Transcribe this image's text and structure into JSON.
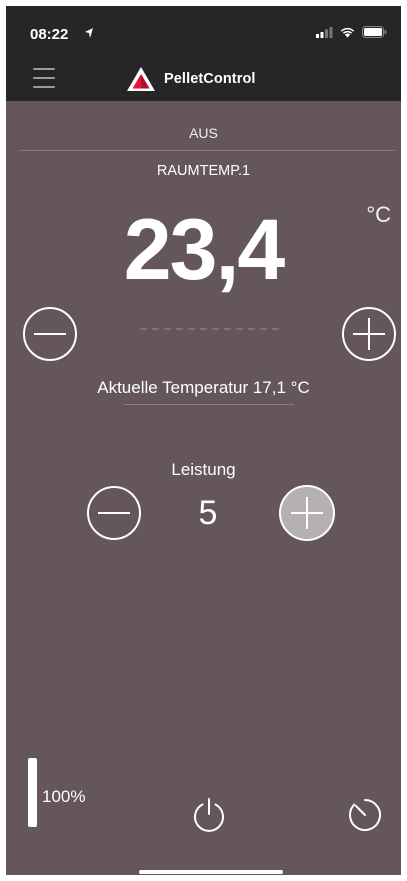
{
  "status_bar": {
    "time": "08:22"
  },
  "header": {
    "app_name": "PelletControl"
  },
  "main": {
    "mode": "AUS",
    "sensor_label": "RAUMTEMP.1",
    "setpoint": "23,4",
    "unit": "°C",
    "current_temperature": "Aktuelle Temperatur 17,1 °C",
    "power_label": "Leistung",
    "power_value": "5"
  },
  "footer": {
    "fuel_level": 1.0,
    "fuel_label": "100%"
  },
  "colors": {
    "background": "#64565a",
    "topbar": "#262626",
    "logo_accent": "#e3153c",
    "active_button": "#b5b0b2"
  },
  "icons": [
    "menu-icon",
    "logo-icon",
    "minus-icon",
    "plus-icon",
    "power-icon",
    "timer-icon",
    "signal-icon",
    "wifi-icon",
    "battery-icon",
    "location-arrow-icon"
  ]
}
